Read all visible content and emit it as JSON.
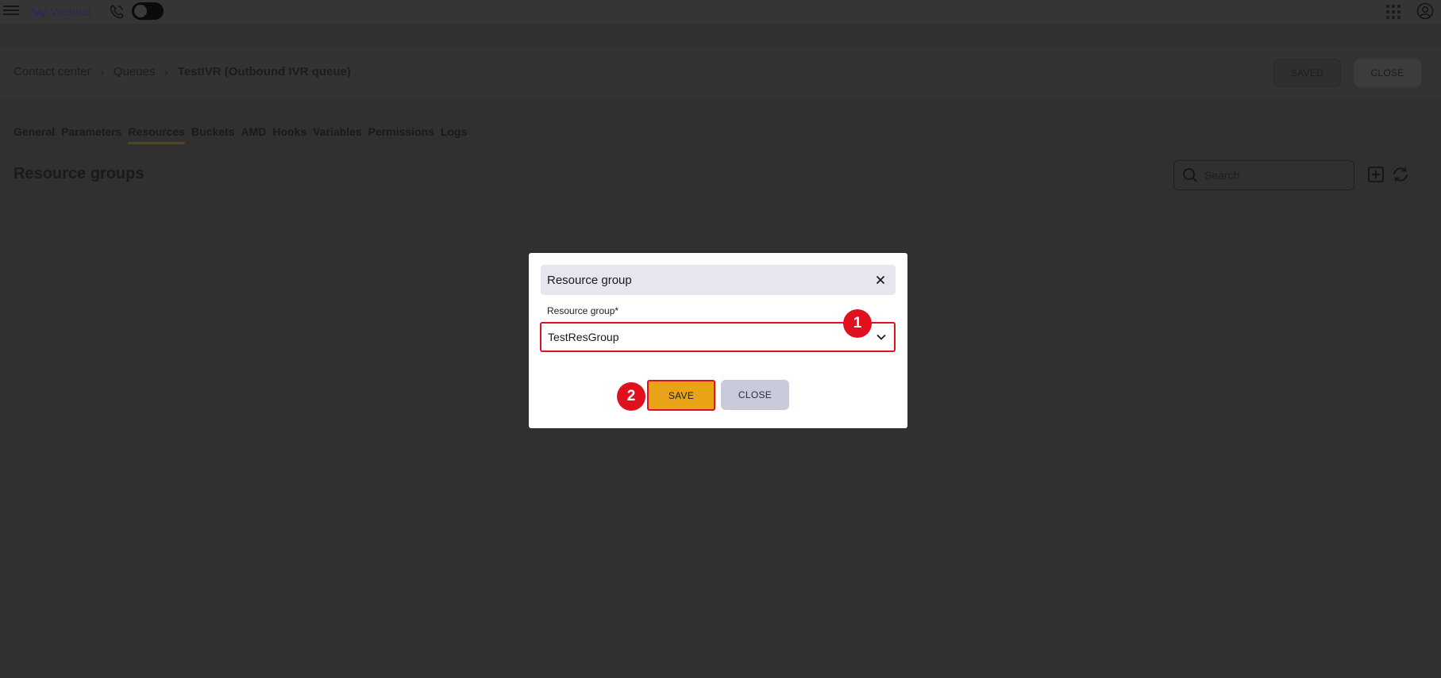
{
  "app": {
    "brand": "Webitel"
  },
  "breadcrumb": {
    "items": [
      "Contact center",
      "Queues",
      "TestIVR (Outbound IVR queue)"
    ]
  },
  "header_actions": {
    "saved_label": "SAVED",
    "close_label": "CLOSE"
  },
  "tabs": [
    "General",
    "Parameters",
    "Resources",
    "Buckets",
    "AMD",
    "Hooks",
    "Variables",
    "Permissions",
    "Logs"
  ],
  "active_tab": "Resources",
  "section": {
    "title": "Resource groups",
    "search_placeholder": "Search"
  },
  "modal": {
    "title": "Resource group",
    "field_label": "Resource group*",
    "selected_value": "TestResGroup",
    "save_label": "SAVE",
    "close_label": "CLOSE"
  },
  "annotations": {
    "step1": "1",
    "step2": "2",
    "highlight_color": "#e0101e"
  },
  "colors": {
    "save_button": "#e8a317",
    "close_button": "#c9cbdb",
    "overlay_background": "#303030"
  },
  "icons": [
    "menu-icon",
    "webitel-logo-icon",
    "phone-icon",
    "theme-toggle",
    "apps-grid-icon",
    "user-account-icon",
    "search-icon",
    "add-icon",
    "refresh-icon",
    "close-icon",
    "chevron-down-icon"
  ]
}
